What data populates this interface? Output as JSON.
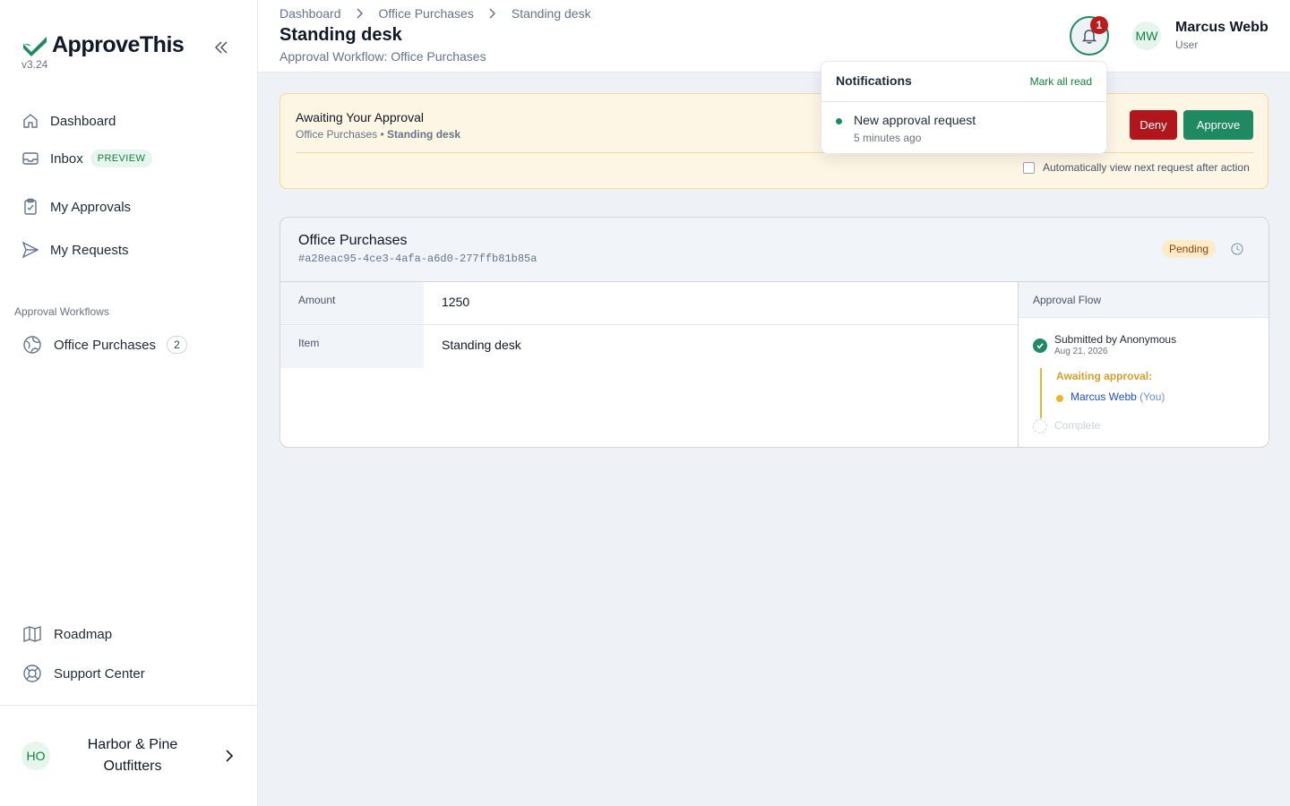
{
  "app": {
    "name": "ApproveThis",
    "version": "v3.24",
    "brand_color": "#1f8a62"
  },
  "sidebar": {
    "items": [
      {
        "label": "Dashboard",
        "icon": "home-icon"
      },
      {
        "label": "Inbox",
        "icon": "inbox-icon",
        "badge": "PREVIEW"
      },
      {
        "label": "My Approvals",
        "icon": "clipboard-check-icon"
      },
      {
        "label": "My Requests",
        "icon": "send-icon"
      }
    ],
    "section_label": "Approval Workflows",
    "workflows": [
      {
        "label": "Office Purchases",
        "count": "2",
        "icon": "globe-icon"
      }
    ],
    "footer_items": [
      {
        "label": "Roadmap",
        "icon": "map-icon"
      },
      {
        "label": "Support Center",
        "icon": "lifebuoy-icon"
      }
    ],
    "org": {
      "initials": "HO",
      "name": "Harbor & Pine Outfitters"
    }
  },
  "header": {
    "breadcrumb": [
      "Dashboard",
      "Office Purchases",
      "Standing desk"
    ],
    "title": "Standing desk",
    "subtitle": "Approval Workflow: Office Purchases",
    "notification_count": "1",
    "user": {
      "initials": "MW",
      "name": "Marcus Webb",
      "role": "User"
    }
  },
  "notifications": {
    "title": "Notifications",
    "mark_all": "Mark all read",
    "items": [
      {
        "title": "New approval request",
        "time": "5 minutes ago"
      }
    ]
  },
  "await_banner": {
    "title": "Awaiting Your Approval",
    "workflow": "Office Purchases",
    "separator": " • ",
    "item": "Standing desk",
    "deny_label": "Deny",
    "approve_label": "Approve",
    "auto_next_label": "Automatically view next request after action",
    "auto_next_checked": false
  },
  "request": {
    "workflow": "Office Purchases",
    "id": "#a28eac95-4ce3-4afa-a6d0-277ffb81b85a",
    "status": "Pending",
    "fields": [
      {
        "label": "Amount",
        "value": "1250"
      },
      {
        "label": "Item",
        "value": "Standing desk"
      }
    ],
    "flow": {
      "title": "Approval Flow",
      "submitted": "Submitted by Anonymous",
      "submitted_date": "Aug 21, 2026",
      "awaiting": "Awaiting approval:",
      "approver": "Marcus Webb",
      "approver_you": "(You)",
      "complete": "Complete"
    }
  }
}
